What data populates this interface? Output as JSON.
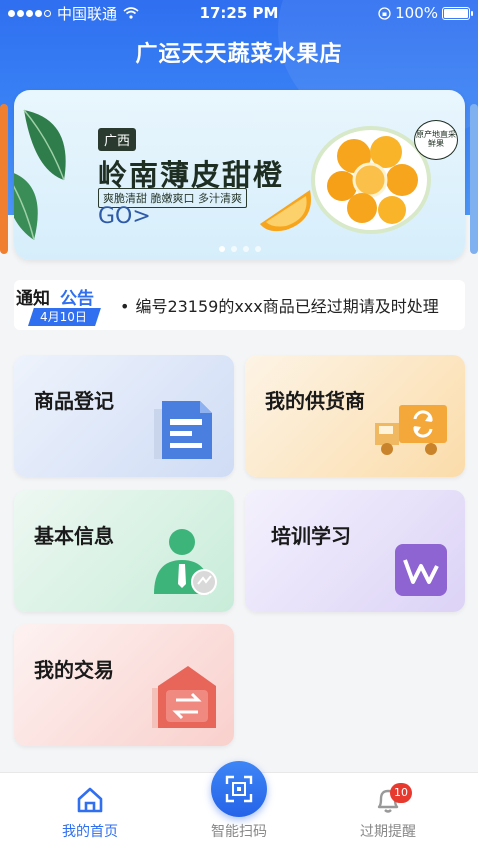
{
  "status_bar": {
    "carrier": "中国联通",
    "time": "17:25 PM",
    "battery": "100%"
  },
  "header": {
    "title": "广运天天蔬菜水果店"
  },
  "banner": {
    "origin_tag": "广西",
    "headline": "岭南薄皮甜橙",
    "tagline": "爽脆清甜 脆嫩爽口 多汁清爽",
    "cta": "GO>",
    "stamp_text": "原产地直采鲜果",
    "slide_count": 4,
    "active_slide": 1
  },
  "notice": {
    "title_part1": "通知",
    "title_part2": "公告",
    "date": "4月10日",
    "bullet": "•",
    "text": "编号23159的xxx商品已经过期请及时处理"
  },
  "menu": [
    {
      "label": "商品登记",
      "icon": "document-icon"
    },
    {
      "label": "我的供货商",
      "icon": "delivery-truck-icon"
    },
    {
      "label": "基本信息",
      "icon": "user-profile-icon"
    },
    {
      "label": "培训学习",
      "icon": "learning-icon"
    },
    {
      "label": "我的交易",
      "icon": "transaction-icon"
    }
  ],
  "tabbar": {
    "home": "我的首页",
    "scan": "智能扫码",
    "remind": "过期提醒",
    "remind_badge": "10"
  },
  "colors": {
    "primary": "#2f6ff0",
    "badge": "#e8392f"
  }
}
